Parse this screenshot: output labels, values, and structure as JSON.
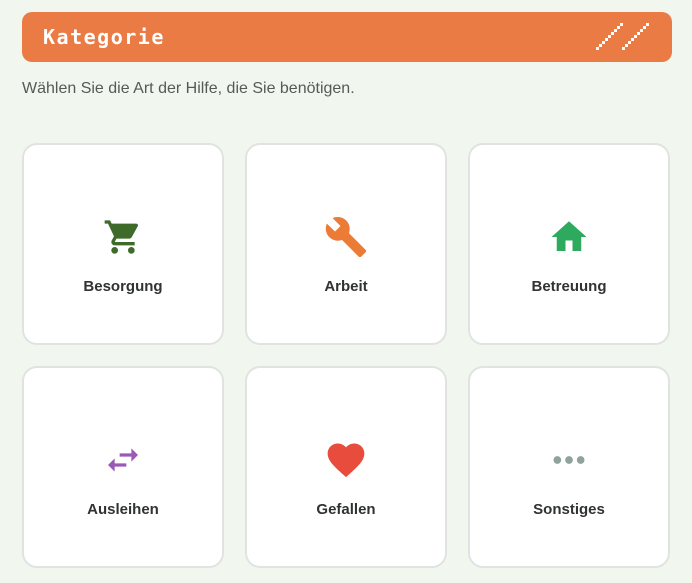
{
  "header": {
    "title": "Kategorie",
    "background_color": "#eb7b45"
  },
  "subtitle": "Wählen Sie die Art der Hilfe, die Sie benötigen.",
  "categories": [
    {
      "label": "Besorgung",
      "icon": "shopping-cart-icon",
      "color": "#3f6b2a"
    },
    {
      "label": "Arbeit",
      "icon": "wrench-icon",
      "color": "#eb7b35"
    },
    {
      "label": "Betreuung",
      "icon": "home-icon",
      "color": "#2eaa5f"
    },
    {
      "label": "Ausleihen",
      "icon": "swap-arrows-icon",
      "color": "#9b59b6"
    },
    {
      "label": "Gefallen",
      "icon": "heart-icon",
      "color": "#e74c3c"
    },
    {
      "label": "Sonstiges",
      "icon": "more-dots-icon",
      "color": "#8fa39a"
    }
  ]
}
